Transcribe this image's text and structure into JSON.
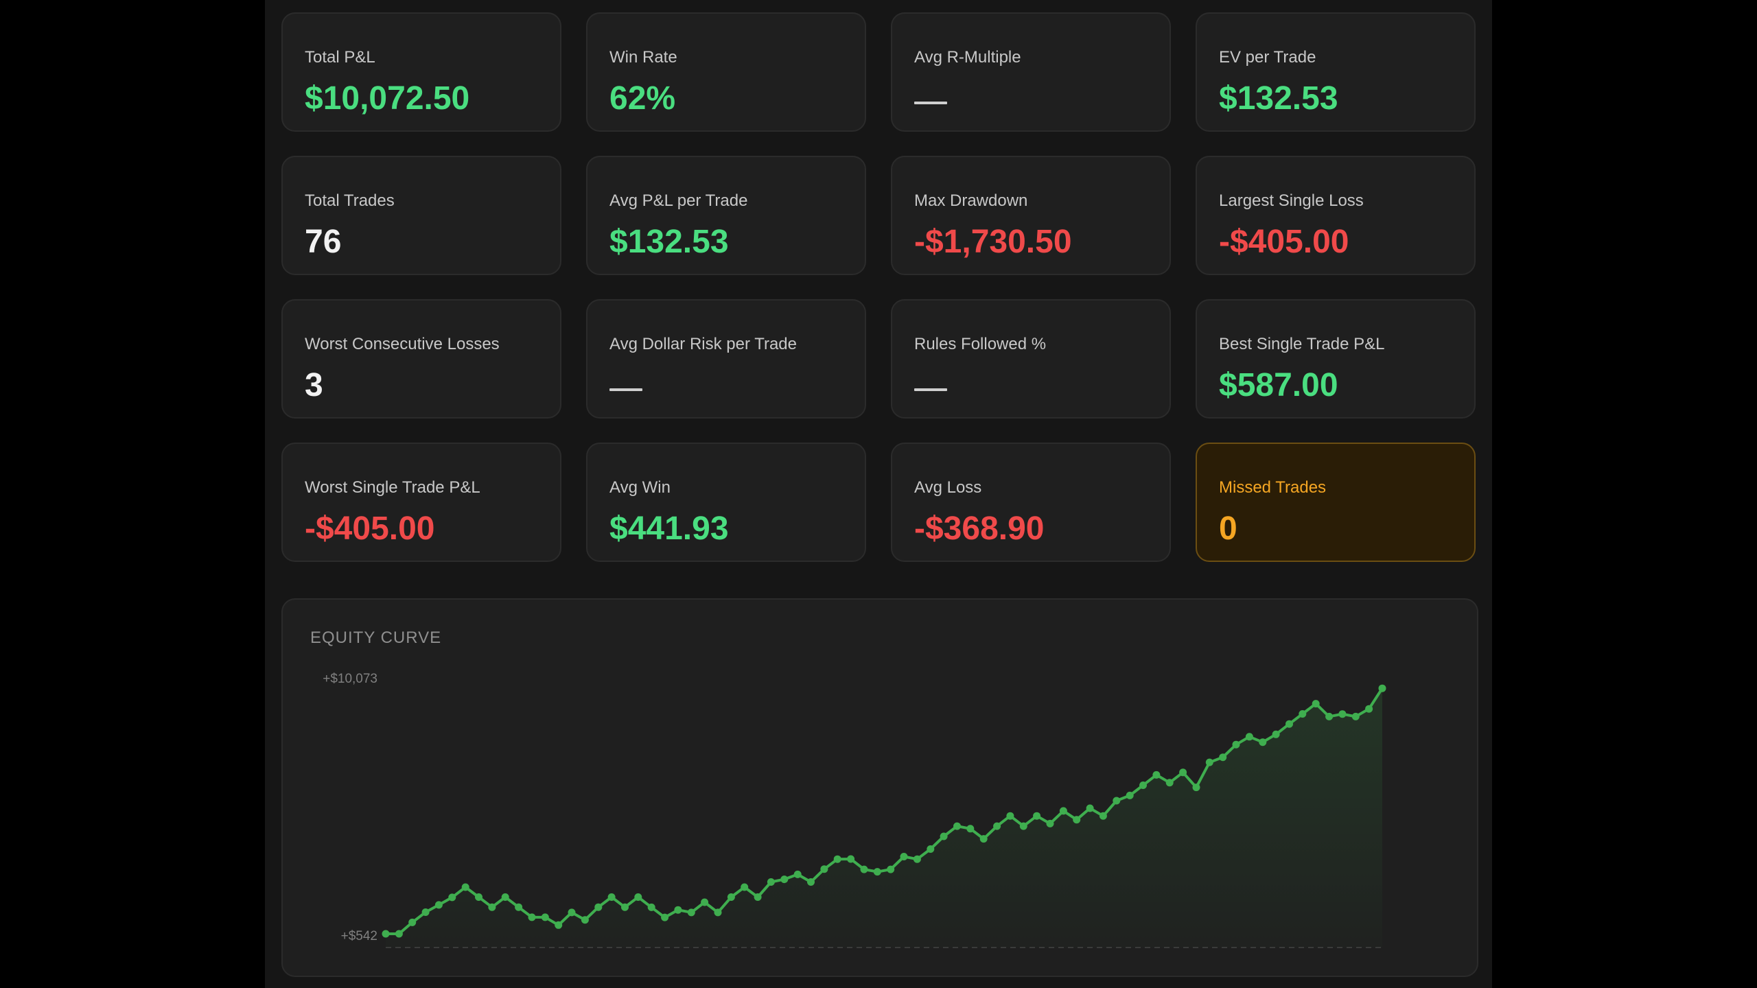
{
  "metrics": {
    "total_pnl": {
      "label": "Total P&L",
      "value": "$10,072.50"
    },
    "win_rate": {
      "label": "Win Rate",
      "value": "62%"
    },
    "avg_r_multiple": {
      "label": "Avg R-Multiple",
      "value": "—"
    },
    "ev_per_trade": {
      "label": "EV per Trade",
      "value": "$132.53"
    },
    "total_trades": {
      "label": "Total Trades",
      "value": "76"
    },
    "avg_pnl_per_trade": {
      "label": "Avg P&L per Trade",
      "value": "$132.53"
    },
    "max_drawdown": {
      "label": "Max Drawdown",
      "value": "-$1,730.50"
    },
    "largest_single_loss": {
      "label": "Largest Single Loss",
      "value": "-$405.00"
    },
    "worst_consecutive_losses": {
      "label": "Worst Consecutive Losses",
      "value": "3"
    },
    "avg_dollar_risk": {
      "label": "Avg Dollar Risk per Trade",
      "value": "—"
    },
    "rules_followed": {
      "label": "Rules Followed %",
      "value": "—"
    },
    "best_single_trade": {
      "label": "Best Single Trade P&L",
      "value": "$587.00"
    },
    "worst_single_trade": {
      "label": "Worst Single Trade P&L",
      "value": "-$405.00"
    },
    "avg_win": {
      "label": "Avg Win",
      "value": "$441.93"
    },
    "avg_loss": {
      "label": "Avg Loss",
      "value": "-$368.90"
    },
    "missed_trades": {
      "label": "Missed Trades",
      "value": "0"
    }
  },
  "colors": {
    "positive": "#4ade80",
    "negative": "#f04a4a",
    "neutral": "#f2f2f2",
    "missed": "#f5a623",
    "line": "#3fae4f",
    "background": "#161616",
    "card": "#1f1f1f"
  },
  "chart_data": {
    "type": "line",
    "title": "EQUITY CURVE",
    "y_tick_labels": [
      "+$10,073",
      "+$542"
    ],
    "ylim": [
      542,
      10073
    ],
    "grid": false,
    "area_fill": true,
    "x": [
      1,
      2,
      3,
      4,
      5,
      6,
      7,
      8,
      9,
      10,
      11,
      12,
      13,
      14,
      15,
      16,
      17,
      18,
      19,
      20,
      21,
      22,
      23,
      24,
      25,
      26,
      27,
      28,
      29,
      30,
      31,
      32,
      33,
      34,
      35,
      36,
      37,
      38,
      39,
      40,
      41,
      42,
      43,
      44,
      45,
      46,
      47,
      48,
      49,
      50,
      51,
      52,
      53,
      54,
      55,
      56,
      57,
      58,
      59,
      60,
      61,
      62,
      63,
      64,
      65,
      66,
      67,
      68,
      69,
      70,
      71,
      72,
      73,
      74,
      75,
      76
    ],
    "values": [
      542,
      542,
      965,
      1345,
      1615,
      1895,
      2275,
      1905,
      1530,
      1905,
      1530,
      1155,
      1155,
      865,
      1335,
      1060,
      1530,
      1905,
      1530,
      1905,
      1525,
      1150,
      1430,
      1335,
      1715,
      1335,
      1905,
      2275,
      1905,
      2465,
      2565,
      2750,
      2465,
      2945,
      3315,
      3320,
      2935,
      2845,
      2935,
      3410,
      3315,
      3690,
      4160,
      4540,
      4445,
      4070,
      4540,
      4920,
      4540,
      4920,
      4635,
      5105,
      4780,
      5205,
      4920,
      5485,
      5680,
      6060,
      6445,
      6155,
      6535,
      5980,
      6910,
      7100,
      7570,
      7860,
      7660,
      7950,
      8335,
      8710,
      9090,
      8610,
      8705,
      8610,
      8895,
      9660
    ]
  }
}
